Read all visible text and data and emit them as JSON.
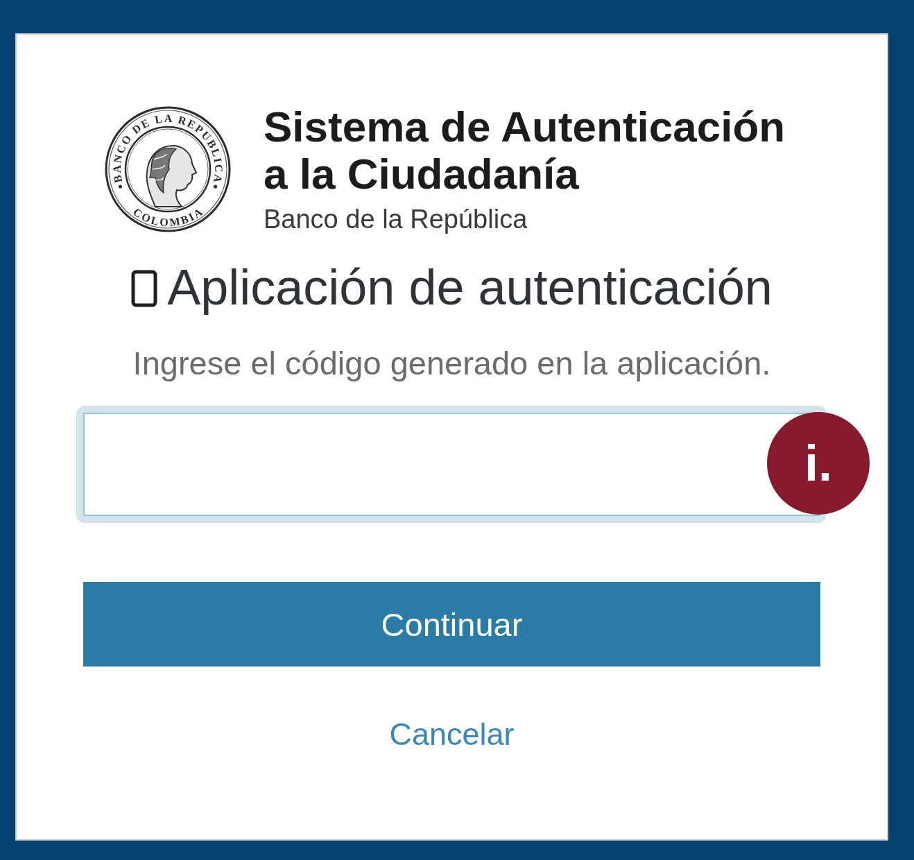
{
  "logo": {
    "seal_top_text": "BANCO DE LA REPUBLICA",
    "seal_bottom_text": "COLOMBIA",
    "title": "Sistema de Autenticación a la Ciudadanía",
    "subtitle": "Banco de la República"
  },
  "heading": "Aplicación de autenticación",
  "instruction": "Ingrese el código generado en la aplicación.",
  "code_field": {
    "focused": true
  },
  "annotation_marker": {
    "label": "i."
  },
  "buttons": [
    {
      "kind": "primary",
      "label": "Continuar"
    },
    {
      "kind": "link",
      "label": "Cancelar"
    }
  ]
}
